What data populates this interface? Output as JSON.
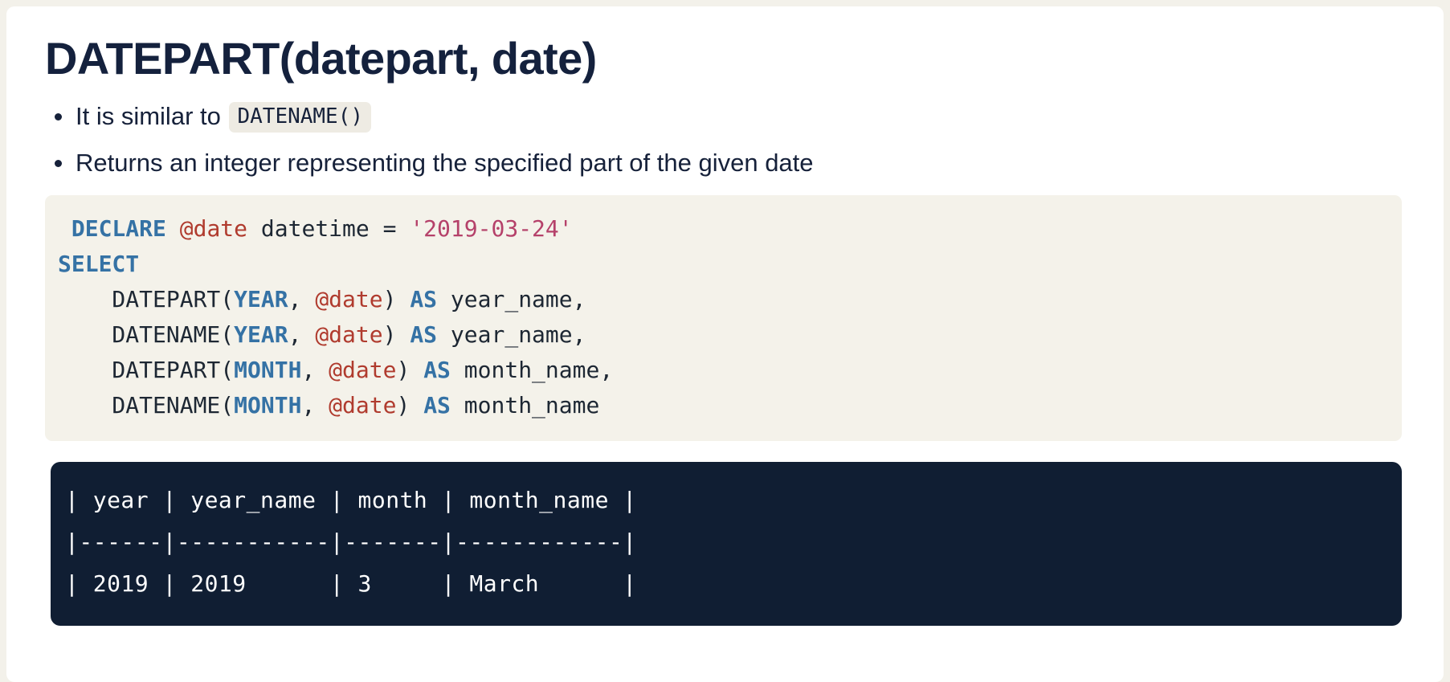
{
  "page": {
    "background_color": "#f3f1ea",
    "card_color": "#ffffff"
  },
  "heading": {
    "title": "DATEPART(datepart, date)"
  },
  "bullets": [
    {
      "text_before": "It is similar to",
      "code": "DATENAME()",
      "text_after": ""
    },
    {
      "text_before": "Returns an integer representing the specified part of the given date",
      "code": "",
      "text_after": ""
    }
  ],
  "code_block": {
    "background_color": "#f4f2ea",
    "language": "sql",
    "colors": {
      "keyword": "#3572a5",
      "variable": "#b03b2e",
      "string": "#b5416a",
      "plain": "#1d2733"
    },
    "lines": [
      [
        {
          "t": " ",
          "c": "plain"
        },
        {
          "t": "DECLARE",
          "c": "keyword"
        },
        {
          "t": " ",
          "c": "plain"
        },
        {
          "t": "@date",
          "c": "variable"
        },
        {
          "t": " datetime = ",
          "c": "plain"
        },
        {
          "t": "'2019-03-24'",
          "c": "string"
        }
      ],
      [
        {
          "t": "SELECT",
          "c": "keyword"
        }
      ],
      [
        {
          "t": "    DATEPART(",
          "c": "plain"
        },
        {
          "t": "YEAR",
          "c": "keyword"
        },
        {
          "t": ", ",
          "c": "plain"
        },
        {
          "t": "@date",
          "c": "variable"
        },
        {
          "t": ") ",
          "c": "plain"
        },
        {
          "t": "AS",
          "c": "keyword"
        },
        {
          "t": " year_name,",
          "c": "plain"
        }
      ],
      [
        {
          "t": "    DATENAME(",
          "c": "plain"
        },
        {
          "t": "YEAR",
          "c": "keyword"
        },
        {
          "t": ", ",
          "c": "plain"
        },
        {
          "t": "@date",
          "c": "variable"
        },
        {
          "t": ") ",
          "c": "plain"
        },
        {
          "t": "AS",
          "c": "keyword"
        },
        {
          "t": " year_name,",
          "c": "plain"
        }
      ],
      [
        {
          "t": "    DATEPART(",
          "c": "plain"
        },
        {
          "t": "MONTH",
          "c": "keyword"
        },
        {
          "t": ", ",
          "c": "plain"
        },
        {
          "t": "@date",
          "c": "variable"
        },
        {
          "t": ") ",
          "c": "plain"
        },
        {
          "t": "AS",
          "c": "keyword"
        },
        {
          "t": " month_name,",
          "c": "plain"
        }
      ],
      [
        {
          "t": "    DATENAME(",
          "c": "plain"
        },
        {
          "t": "MONTH",
          "c": "keyword"
        },
        {
          "t": ", ",
          "c": "plain"
        },
        {
          "t": "@date",
          "c": "variable"
        },
        {
          "t": ") ",
          "c": "plain"
        },
        {
          "t": "AS",
          "c": "keyword"
        },
        {
          "t": " month_name",
          "c": "plain"
        }
      ]
    ]
  },
  "output_block": {
    "background_color": "#101e33",
    "text_color": "#ffffff",
    "lines": [
      "| year | year_name | month | month_name |",
      "|------|-----------|-------|------------|",
      "| 2019 | 2019      | 3     | March      |"
    ],
    "table": {
      "headers": [
        "year",
        "year_name",
        "month",
        "month_name"
      ],
      "rows": [
        [
          "2019",
          "2019",
          "3",
          "March"
        ]
      ]
    }
  }
}
